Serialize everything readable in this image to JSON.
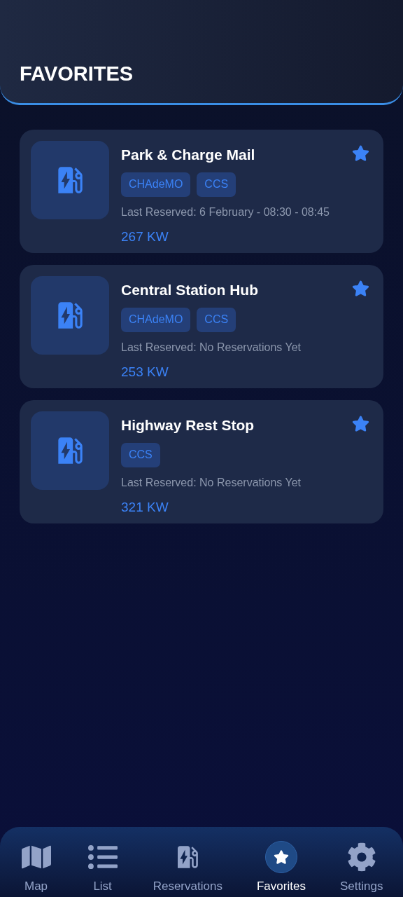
{
  "header": {
    "title": "FAVORITES"
  },
  "stations": [
    {
      "name": "Park & Charge Mail",
      "favorite": true,
      "connectors": [
        "CHAdeMO",
        "CCS"
      ],
      "last_reserved": "Last Reserved: 6 February - 08:30 - 08:45",
      "power": "267 KW"
    },
    {
      "name": "Central Station Hub",
      "favorite": true,
      "connectors": [
        "CHAdeMO",
        "CCS"
      ],
      "last_reserved": "Last Reserved: No Reservations Yet",
      "power": "253 KW"
    },
    {
      "name": "Highway Rest Stop",
      "favorite": true,
      "connectors": [
        "CCS"
      ],
      "last_reserved": "Last Reserved: No Reservations Yet",
      "power": "321 KW"
    }
  ],
  "nav": [
    {
      "kind": "map",
      "label": "Map",
      "selected": false
    },
    {
      "kind": "list",
      "label": "List",
      "selected": false
    },
    {
      "kind": "reservations",
      "label": "Reservations",
      "selected": false
    },
    {
      "kind": "favorites",
      "label": "Favorites",
      "selected": true
    },
    {
      "kind": "settings",
      "label": "Settings",
      "selected": false
    }
  ]
}
